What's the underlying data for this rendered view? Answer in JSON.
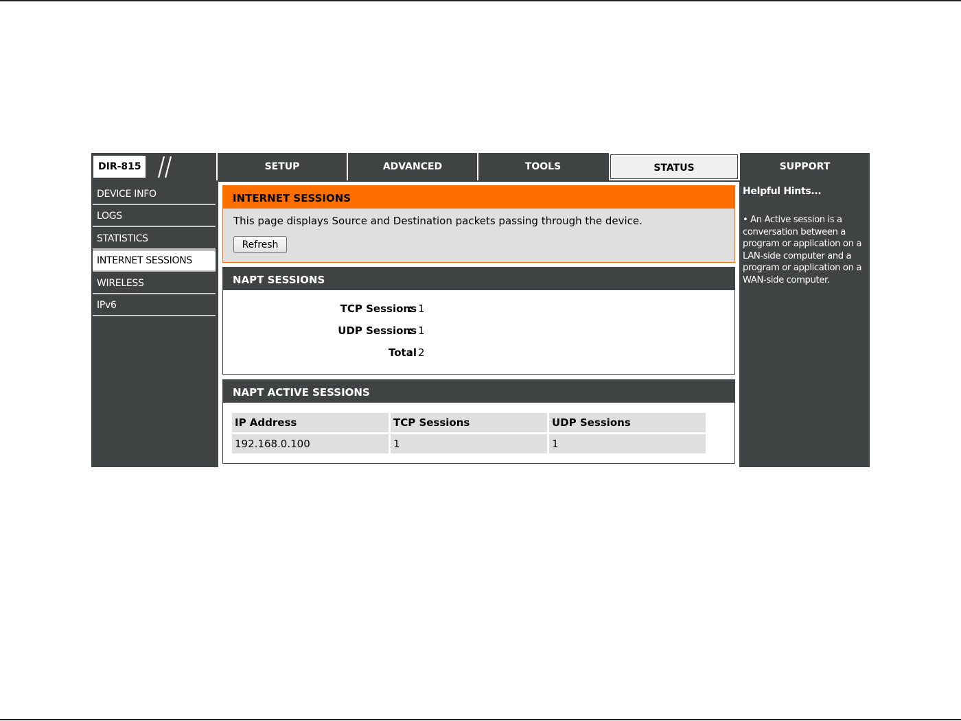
{
  "header": {
    "model": "DIR-815",
    "tabs": [
      {
        "label": "SETUP"
      },
      {
        "label": "ADVANCED"
      },
      {
        "label": "TOOLS"
      },
      {
        "label": "STATUS"
      },
      {
        "label": "SUPPORT"
      }
    ],
    "active_tab": "STATUS"
  },
  "sidebar": {
    "items": [
      {
        "label": "DEVICE INFO"
      },
      {
        "label": "LOGS"
      },
      {
        "label": "STATISTICS"
      },
      {
        "label": "INTERNET SESSIONS"
      },
      {
        "label": "WIRELESS"
      },
      {
        "label": "IPv6"
      }
    ],
    "active_item": "INTERNET SESSIONS"
  },
  "internet_sessions": {
    "title": "INTERNET SESSIONS",
    "description": "This page displays Source and Destination packets passing through the device.",
    "refresh_label": "Refresh"
  },
  "napt_sessions": {
    "title": "NAPT SESSIONS",
    "rows": [
      {
        "label": "TCP Sessions",
        "colon": ":",
        "value": "1"
      },
      {
        "label": "UDP Sessions",
        "colon": ":",
        "value": "1"
      },
      {
        "label": "Total",
        "colon": ":",
        "value": "2"
      }
    ]
  },
  "napt_active_sessions": {
    "title": "NAPT ACTIVE SESSIONS",
    "columns": [
      "IP Address",
      "TCP Sessions",
      "UDP Sessions"
    ],
    "rows": [
      [
        "192.168.0.100",
        "1",
        "1"
      ]
    ]
  },
  "hints": {
    "title": "Helpful Hints...",
    "text": "• An Active session is a conversation between a program or application on a LAN-side computer and a program or application on a WAN-side computer."
  },
  "colors": {
    "dark": "#404343",
    "orange": "#ff6f00",
    "light_grey": "#dfdfdf"
  }
}
